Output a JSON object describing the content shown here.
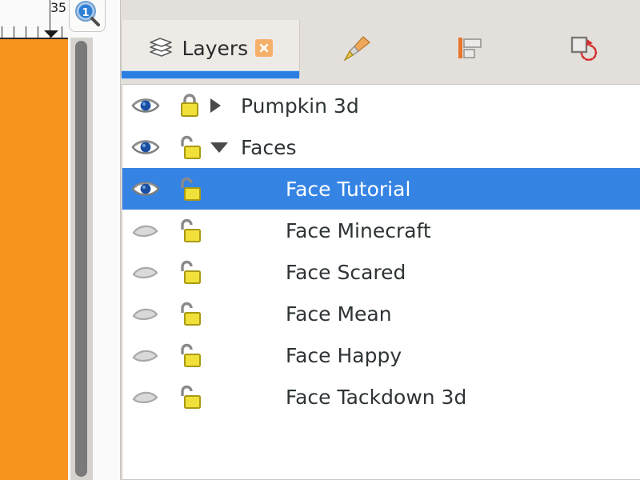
{
  "canvas": {
    "ruler_label": "35",
    "doc_color": "#f6941e",
    "zoom_badge_label": "1",
    "zoom_badge_icon": "magnifier-one-to-one-icon"
  },
  "panel": {
    "tabs": [
      {
        "id": "layers",
        "label": "Layers",
        "icon": "layers-stack-icon",
        "active": true,
        "closable": true
      },
      {
        "id": "brush",
        "label": "",
        "icon": "paintbrush-icon",
        "active": false,
        "closable": false
      },
      {
        "id": "align",
        "label": "",
        "icon": "align-left-icon",
        "active": false,
        "closable": false
      },
      {
        "id": "transform",
        "label": "",
        "icon": "transform-rotate-icon",
        "active": false,
        "closable": false
      }
    ],
    "close_glyph": "×",
    "accent_color": "#2b7ee0",
    "selection_color": "#3584e4"
  },
  "layers": [
    {
      "name": "Pumpkin 3d",
      "visible": true,
      "locked": true,
      "expanded": false,
      "child": false,
      "selected": false
    },
    {
      "name": "Faces",
      "visible": true,
      "locked": false,
      "expanded": true,
      "child": false,
      "selected": false
    },
    {
      "name": "Face Tutorial",
      "visible": true,
      "locked": false,
      "expanded": null,
      "child": true,
      "selected": true
    },
    {
      "name": "Face Minecraft",
      "visible": false,
      "locked": false,
      "expanded": null,
      "child": true,
      "selected": false
    },
    {
      "name": "Face Scared",
      "visible": false,
      "locked": false,
      "expanded": null,
      "child": true,
      "selected": false
    },
    {
      "name": "Face Mean",
      "visible": false,
      "locked": false,
      "expanded": null,
      "child": true,
      "selected": false
    },
    {
      "name": "Face Happy",
      "visible": false,
      "locked": false,
      "expanded": null,
      "child": true,
      "selected": false
    },
    {
      "name": "Face Tackdown 3d",
      "visible": false,
      "locked": false,
      "expanded": null,
      "child": true,
      "selected": false
    }
  ]
}
